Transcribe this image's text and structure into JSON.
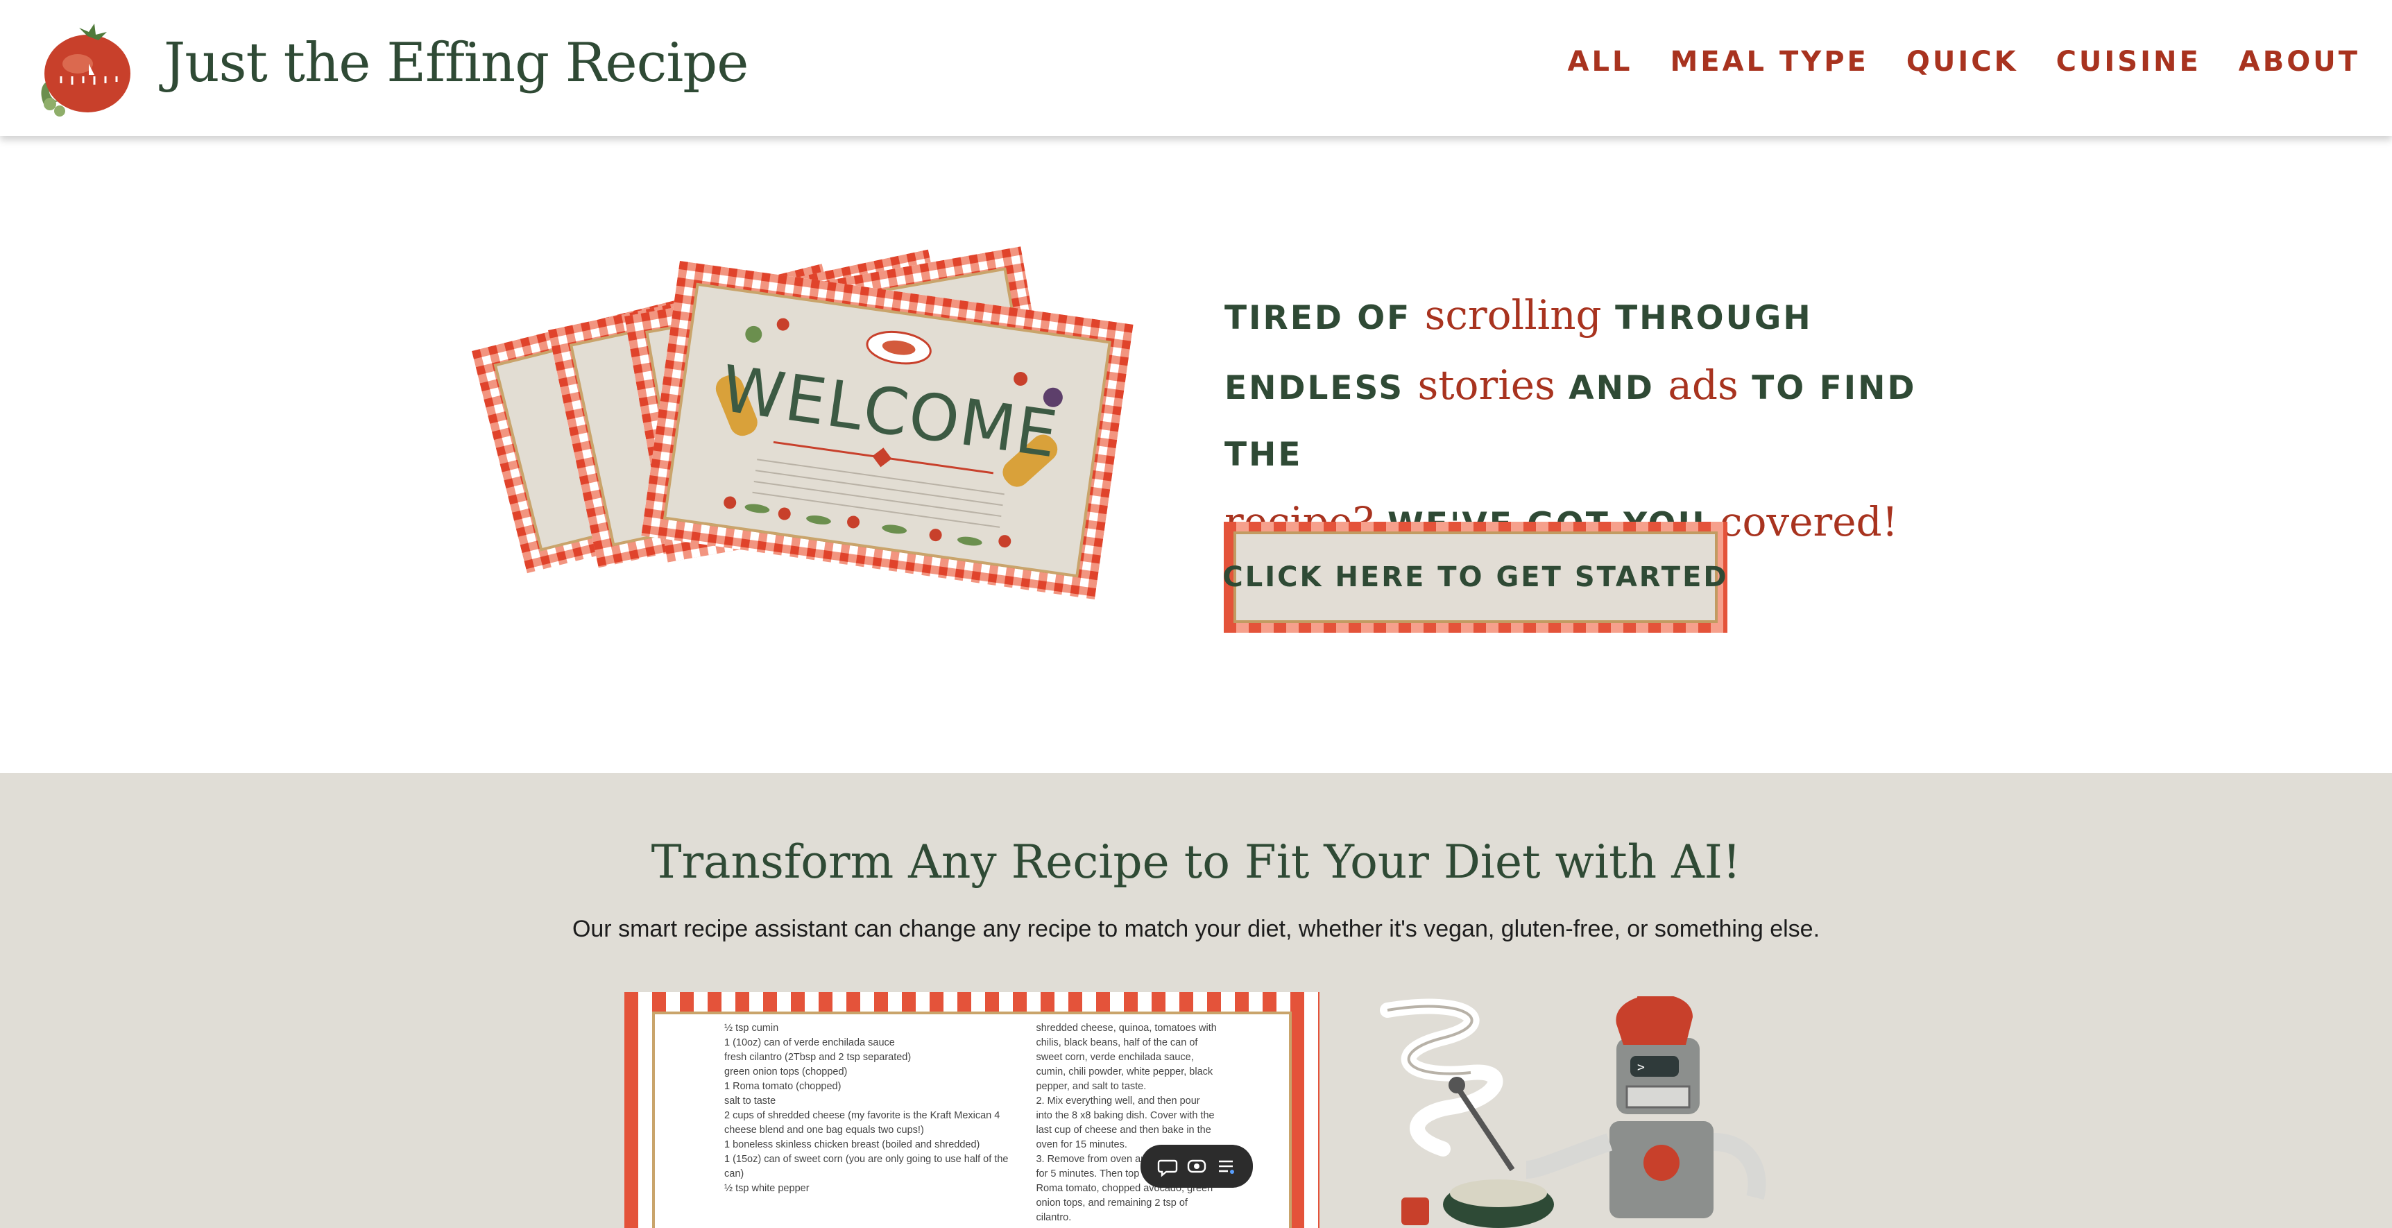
{
  "header": {
    "site_title": "Just the Effing Recipe",
    "logo_icon": "tomato-timer-icon",
    "nav": [
      {
        "label": "ALL"
      },
      {
        "label": "MEAL TYPE"
      },
      {
        "label": "QUICK"
      },
      {
        "label": "CUISINE"
      },
      {
        "label": "ABOUT"
      }
    ]
  },
  "hero": {
    "art_text": "WELCOME",
    "line1": {
      "a": "Tired of",
      "b": "scrolling",
      "c": "through"
    },
    "line2": {
      "a": "endless",
      "b": "stories",
      "c": "and",
      "d": "ads",
      "e": "to find the"
    },
    "line3": {
      "a": "recipe?",
      "b": "We've got you",
      "c": "covered!"
    },
    "cta_label": "CLICK HERE TO GET STARTED"
  },
  "ai_section": {
    "title": "Transform Any Recipe to Fit Your Diet with AI!",
    "subtitle": "Our smart recipe assistant can change any recipe to match your diet, whether it's vegan, gluten-free, or something else.",
    "recipe_left": [
      "½ tsp cumin",
      "1 (10oz) can of verde enchilada sauce",
      "fresh cilantro (2Tbsp and 2 tsp separated)",
      "green onion tops (chopped)",
      "1 Roma tomato (chopped)",
      "salt to taste",
      "2 cups of shredded cheese (my favorite is the Kraft Mexican 4",
      "cheese blend and one bag equals two cups!)",
      "1 boneless skinless chicken breast (boiled and shredded)",
      "1 (15oz) can of sweet corn (you are only going to use half of the",
      "can)",
      "½ tsp white pepper"
    ],
    "recipe_right": [
      "shredded cheese, quinoa, tomatoes with",
      "chilis, black beans, half of the can of",
      "sweet corn, verde enchilada sauce,",
      "cumin, chili powder, white pepper, black",
      "pepper, and salt to taste.",
      "2. Mix everything well, and then pour",
      "into the 8 x8 baking dish. Cover with the",
      "last cup of cheese and then bake in the",
      "oven for 15 minutes.",
      "3. Remove from oven and",
      "for 5 minutes. Then top",
      "Roma tomato, chopped avocado, green",
      "onion tops, and remaining 2 tsp of",
      "cilantro."
    ],
    "toolbar_icons": [
      "comment-icon",
      "eye-icon",
      "list-icon"
    ]
  },
  "colors": {
    "brand_green": "#2f4a35",
    "brand_red": "#a8331f",
    "section_bg": "#e0ddd6",
    "gingham": "#e4533a"
  }
}
